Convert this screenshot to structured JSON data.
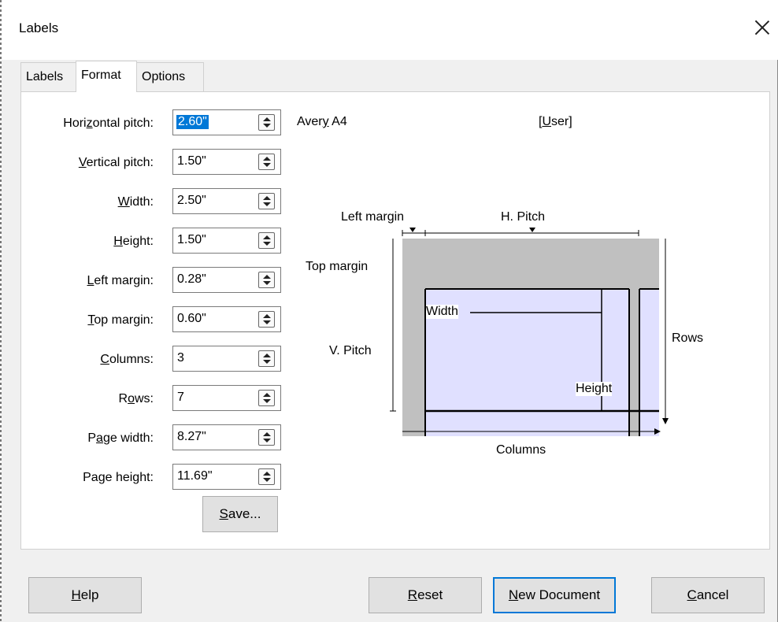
{
  "window": {
    "title": "Labels"
  },
  "tabs": [
    {
      "label": "Labels",
      "active": false
    },
    {
      "label": "Format",
      "active": true
    },
    {
      "label": "Options",
      "active": false
    }
  ],
  "fields": [
    {
      "label": "Horizontal pitch:",
      "value": "2.60\"",
      "selected": true
    },
    {
      "label": "Vertical pitch:",
      "value": "1.50\""
    },
    {
      "label": "Width:",
      "value": "2.50\""
    },
    {
      "label": "Height:",
      "value": "1.50\""
    },
    {
      "label": "Left margin:",
      "value": "0.28\""
    },
    {
      "label": "Top margin:",
      "value": "0.60\""
    },
    {
      "label": "Columns:",
      "value": "3"
    },
    {
      "label": "Rows:",
      "value": "7"
    },
    {
      "label": "Page width:",
      "value": "8.27\""
    },
    {
      "label": "Page height:",
      "value": "11.69\""
    }
  ],
  "save_button": "Save...",
  "brand": "Avery A4",
  "type": "[User]",
  "diagram": {
    "left_margin": "Left margin",
    "h_pitch": "H. Pitch",
    "top_margin": "Top margin",
    "v_pitch": "V. Pitch",
    "width": "Width",
    "height": "Height",
    "rows": "Rows",
    "columns": "Columns"
  },
  "buttons": {
    "help": "Help",
    "reset": "Reset",
    "new_document": "New Document",
    "cancel": "Cancel"
  },
  "colors": {
    "label_fill": "#e0e0ff",
    "sheet_gray": "#c0c0c0",
    "accent": "#0078d7"
  }
}
